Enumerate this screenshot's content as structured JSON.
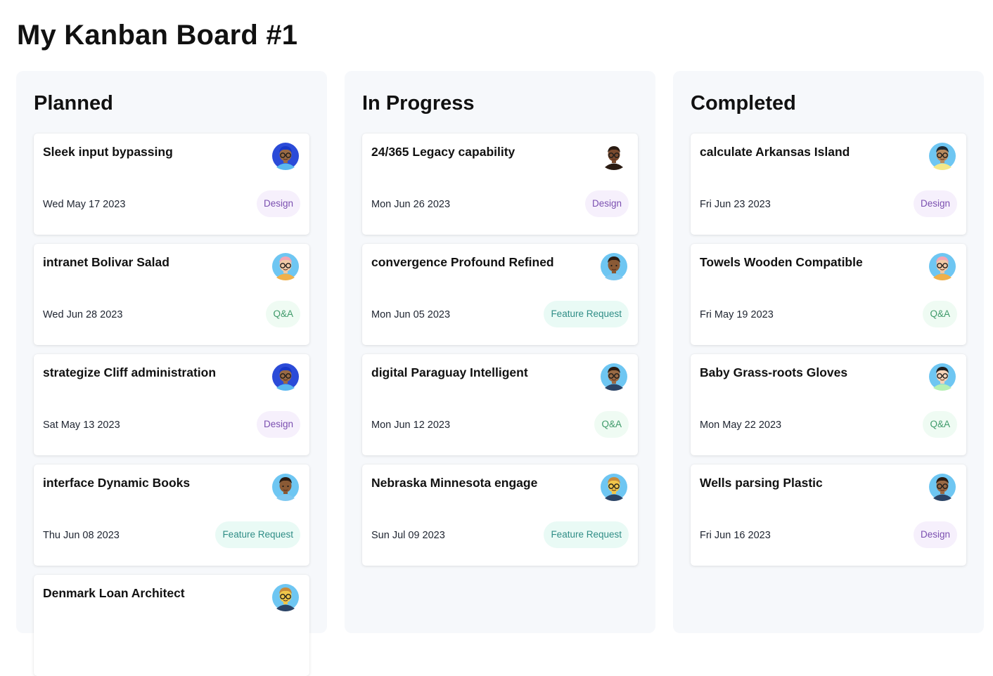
{
  "board": {
    "title": "My Kanban Board #1"
  },
  "columns": [
    {
      "title": "Planned",
      "cards": [
        {
          "title": "Sleek input bypassing",
          "date": "Wed May 17 2023",
          "tag": "Design",
          "tag_type": "design",
          "avatar": {
            "bg": "#2b4bd8",
            "skin": "#9a6a44",
            "hair": "#1637c9",
            "shirt": "#5ab8f0",
            "glasses": true
          }
        },
        {
          "title": "intranet Bolivar Salad",
          "date": "Wed Jun 28 2023",
          "tag": "Q&A",
          "tag_type": "qa",
          "avatar": {
            "bg": "#6ec6f2",
            "skin": "#f1c9a5",
            "hair": "#f3a6b4",
            "shirt": "#f0b04a",
            "glasses": true
          }
        },
        {
          "title": "strategize Cliff administration",
          "date": "Sat May 13 2023",
          "tag": "Design",
          "tag_type": "design",
          "avatar": {
            "bg": "#2b4bd8",
            "skin": "#9a6a44",
            "hair": "#1637c9",
            "shirt": "#5ab8f0",
            "glasses": true
          }
        },
        {
          "title": "interface Dynamic Books",
          "date": "Thu Jun 08 2023",
          "tag": "Feature Request",
          "tag_type": "feature",
          "avatar": {
            "bg": "#6ec6f2",
            "skin": "#8a5a35",
            "hair": "#2a1b12",
            "shirt": "#7fc8f0",
            "glasses": false
          }
        },
        {
          "title": "Denmark Loan Architect",
          "date": "",
          "tag": "",
          "tag_type": "",
          "avatar": {
            "bg": "#6ec6f2",
            "skin": "#f0c64a",
            "hair": "#c88a3a",
            "shirt": "#2b4466",
            "glasses": true
          }
        }
      ]
    },
    {
      "title": "In Progress",
      "cards": [
        {
          "title": "24/365 Legacy capability",
          "date": "Mon Jun 26 2023",
          "tag": "Design",
          "tag_type": "design",
          "avatar": {
            "bg": "#ffffff",
            "skin": "#7a4a2e",
            "hair": "#2a1b12",
            "shirt": "#2a1b12",
            "glasses": true
          }
        },
        {
          "title": "convergence Profound Refined",
          "date": "Mon Jun 05 2023",
          "tag": "Feature Request",
          "tag_type": "feature",
          "avatar": {
            "bg": "#6ec6f2",
            "skin": "#8a5a35",
            "hair": "#2a1b12",
            "shirt": "#7fc8f0",
            "glasses": false
          }
        },
        {
          "title": "digital Paraguay Intelligent",
          "date": "Mon Jun 12 2023",
          "tag": "Q&A",
          "tag_type": "qa",
          "avatar": {
            "bg": "#6ec6f2",
            "skin": "#9a6a44",
            "hair": "#2a1b12",
            "shirt": "#2b4466",
            "glasses": true
          }
        },
        {
          "title": "Nebraska Minnesota engage",
          "date": "Sun Jul 09 2023",
          "tag": "Feature Request",
          "tag_type": "feature",
          "avatar": {
            "bg": "#6ec6f2",
            "skin": "#f0c64a",
            "hair": "#c88a3a",
            "shirt": "#2b4466",
            "glasses": true
          }
        }
      ]
    },
    {
      "title": "Completed",
      "cards": [
        {
          "title": "calculate Arkansas Island",
          "date": "Fri Jun 23 2023",
          "tag": "Design",
          "tag_type": "design",
          "avatar": {
            "bg": "#6ec6f2",
            "skin": "#b88a5e",
            "hair": "#1e2a33",
            "shirt": "#f4e889",
            "glasses": true
          }
        },
        {
          "title": "Towels Wooden Compatible",
          "date": "Fri May 19 2023",
          "tag": "Q&A",
          "tag_type": "qa",
          "avatar": {
            "bg": "#6ec6f2",
            "skin": "#f1c9a5",
            "hair": "#f3a6b4",
            "shirt": "#f0b04a",
            "glasses": true
          }
        },
        {
          "title": "Baby Grass-roots Gloves",
          "date": "Mon May 22 2023",
          "tag": "Q&A",
          "tag_type": "qa",
          "avatar": {
            "bg": "#6ec6f2",
            "skin": "#f5d3b8",
            "hair": "#1e1e1e",
            "shirt": "#b6f0b4",
            "glasses": true
          }
        },
        {
          "title": "Wells parsing Plastic",
          "date": "Fri Jun 16 2023",
          "tag": "Design",
          "tag_type": "design",
          "avatar": {
            "bg": "#6ec6f2",
            "skin": "#9a6a44",
            "hair": "#2a1b12",
            "shirt": "#2b4466",
            "glasses": true
          }
        }
      ]
    }
  ]
}
